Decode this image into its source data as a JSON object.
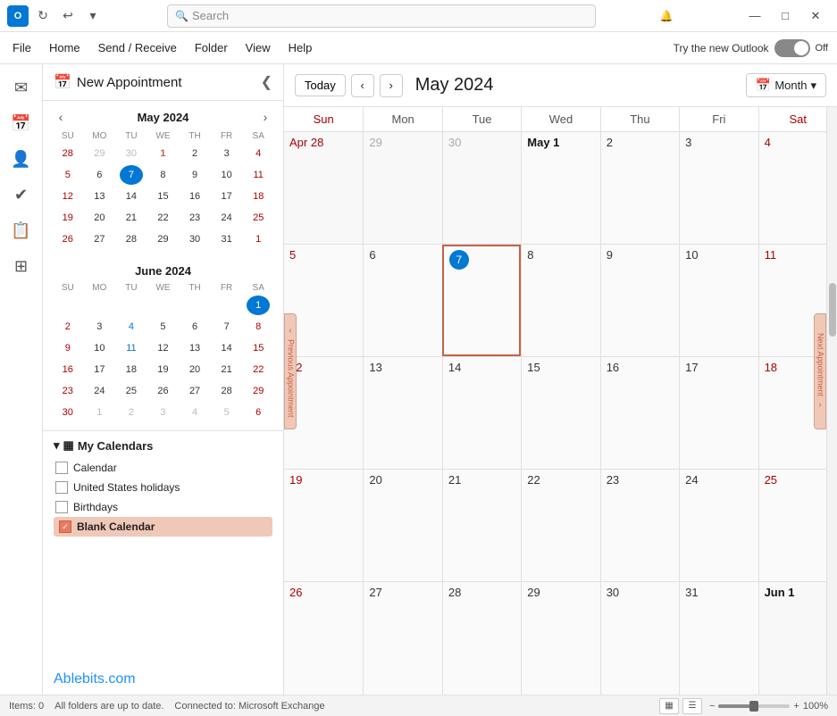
{
  "titlebar": {
    "logo": "O",
    "search_placeholder": "Search",
    "bell_icon": "🔔",
    "minimize": "—",
    "maximize": "□",
    "close": "✕"
  },
  "menubar": {
    "items": [
      "File",
      "Home",
      "Send / Receive",
      "Folder",
      "View",
      "Help"
    ],
    "try_new_label": "Try the new Outlook",
    "toggle_label": "Off"
  },
  "left_nav": {
    "icons": [
      {
        "name": "mail-icon",
        "symbol": "✉",
        "active": false
      },
      {
        "name": "calendar-icon",
        "symbol": "📅",
        "active": true
      },
      {
        "name": "contacts-icon",
        "symbol": "👤",
        "active": false
      },
      {
        "name": "tasks-icon",
        "symbol": "✔",
        "active": false
      },
      {
        "name": "notes-icon",
        "symbol": "📋",
        "active": false
      },
      {
        "name": "apps-icon",
        "symbol": "⊞",
        "active": false
      }
    ]
  },
  "sidebar": {
    "new_appointment_label": "New Appointment",
    "collapse_icon": "❮",
    "mini_cal_may": {
      "title": "May 2024",
      "day_headers": [
        "SU",
        "MO",
        "TU",
        "WE",
        "TH",
        "FR",
        "SA"
      ],
      "weeks": [
        [
          {
            "day": 28,
            "other": true
          },
          {
            "day": 29,
            "other": true
          },
          {
            "day": 30,
            "other": true
          },
          {
            "day": 1,
            "sat": false,
            "sun": false
          },
          {
            "day": 2
          },
          {
            "day": 3
          },
          {
            "day": 4
          }
        ],
        [
          {
            "day": 5
          },
          {
            "day": 6
          },
          {
            "day": 7,
            "selected": true
          },
          {
            "day": 8
          },
          {
            "day": 9
          },
          {
            "day": 10
          },
          {
            "day": 11
          }
        ],
        [
          {
            "day": 12
          },
          {
            "day": 13
          },
          {
            "day": 14
          },
          {
            "day": 15
          },
          {
            "day": 16
          },
          {
            "day": 17
          },
          {
            "day": 18
          }
        ],
        [
          {
            "day": 19
          },
          {
            "day": 20
          },
          {
            "day": 21
          },
          {
            "day": 22
          },
          {
            "day": 23
          },
          {
            "day": 24
          },
          {
            "day": 25
          }
        ],
        [
          {
            "day": 26
          },
          {
            "day": 27
          },
          {
            "day": 28
          },
          {
            "day": 29
          },
          {
            "day": 30
          },
          {
            "day": 31
          },
          {
            "day": 1,
            "other": true
          }
        ]
      ]
    },
    "mini_cal_june": {
      "title": "June 2024",
      "day_headers": [
        "SU",
        "MO",
        "TU",
        "WE",
        "TH",
        "FR",
        "SA"
      ],
      "weeks": [
        [
          {
            "day": ""
          },
          {
            "day": ""
          },
          {
            "day": ""
          },
          {
            "day": ""
          },
          {
            "day": ""
          },
          {
            "day": ""
          },
          {
            "day": 1
          }
        ],
        [
          {
            "day": 2
          },
          {
            "day": 3
          },
          {
            "day": 4
          },
          {
            "day": 5
          },
          {
            "day": 6
          },
          {
            "day": 7
          },
          {
            "day": 8
          }
        ],
        [
          {
            "day": 9
          },
          {
            "day": 10
          },
          {
            "day": 11
          },
          {
            "day": 12
          },
          {
            "day": 13
          },
          {
            "day": 14
          },
          {
            "day": 15
          }
        ],
        [
          {
            "day": 16
          },
          {
            "day": 17
          },
          {
            "day": 18
          },
          {
            "day": 19
          },
          {
            "day": 20
          },
          {
            "day": 21
          },
          {
            "day": 22
          }
        ],
        [
          {
            "day": 23
          },
          {
            "day": 24
          },
          {
            "day": 25
          },
          {
            "day": 26
          },
          {
            "day": 27
          },
          {
            "day": 28
          },
          {
            "day": 29
          }
        ],
        [
          {
            "day": 30
          },
          {
            "day": 1,
            "other": true
          },
          {
            "day": 2,
            "other": true
          },
          {
            "day": 3,
            "other": true
          },
          {
            "day": 4,
            "other": true
          },
          {
            "day": 5,
            "other": true
          },
          {
            "day": 6,
            "other": true
          }
        ]
      ]
    },
    "my_calendars_label": "My Calendars",
    "calendars": [
      {
        "label": "Calendar",
        "checked": false
      },
      {
        "label": "United States holidays",
        "checked": false
      },
      {
        "label": "Birthdays",
        "checked": false
      },
      {
        "label": "Blank Calendar",
        "checked": true,
        "highlighted": true
      }
    ],
    "ablebits_label": "Ablebits.com"
  },
  "calendar": {
    "today_btn": "Today",
    "prev_icon": "‹",
    "next_icon": "›",
    "title": "May 2024",
    "view_btn": "Month",
    "day_headers": [
      {
        "label": "Sun",
        "type": "sunday"
      },
      {
        "label": "Mon",
        "type": "normal"
      },
      {
        "label": "Tue",
        "type": "normal"
      },
      {
        "label": "Wed",
        "type": "normal"
      },
      {
        "label": "Thu",
        "type": "normal"
      },
      {
        "label": "Fri",
        "type": "normal"
      },
      {
        "label": "Sat",
        "type": "saturday"
      }
    ],
    "weeks": [
      [
        {
          "num": "Apr 28",
          "other": true
        },
        {
          "num": "29",
          "other": true
        },
        {
          "num": "30",
          "other": true
        },
        {
          "num": "May 1",
          "bold": true
        },
        {
          "num": "2"
        },
        {
          "num": "3"
        },
        {
          "num": "4"
        }
      ],
      [
        {
          "num": "5"
        },
        {
          "num": "6"
        },
        {
          "num": "7",
          "today": true
        },
        {
          "num": "8"
        },
        {
          "num": "9"
        },
        {
          "num": "10"
        },
        {
          "num": "11"
        }
      ],
      [
        {
          "num": "12"
        },
        {
          "num": "13"
        },
        {
          "num": "14"
        },
        {
          "num": "15"
        },
        {
          "num": "16"
        },
        {
          "num": "17"
        },
        {
          "num": "18"
        }
      ],
      [
        {
          "num": "19"
        },
        {
          "num": "20"
        },
        {
          "num": "21"
        },
        {
          "num": "22"
        },
        {
          "num": "23"
        },
        {
          "num": "24"
        },
        {
          "num": "25"
        }
      ],
      [
        {
          "num": "26"
        },
        {
          "num": "27"
        },
        {
          "num": "28"
        },
        {
          "num": "29"
        },
        {
          "num": "30"
        },
        {
          "num": "31"
        },
        {
          "num": "Jun 1",
          "bold": true
        }
      ]
    ],
    "prev_appt_label": "Previous Appointment",
    "next_appt_label": "Next Appointment"
  },
  "statusbar": {
    "items_label": "Items: 0",
    "status_text": "All folders are up to date.",
    "connection_text": "Connected to: Microsoft Exchange",
    "zoom_label": "100%"
  }
}
